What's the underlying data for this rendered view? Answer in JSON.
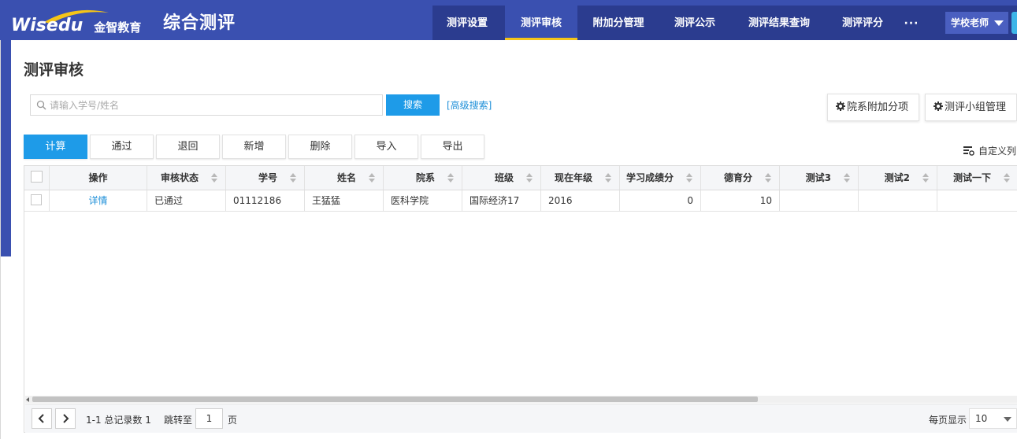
{
  "header": {
    "logo_text": "Wisedu",
    "logo_cn": "金智教育",
    "app_title": "综合测评",
    "nav": [
      {
        "label": "测评设置",
        "active": false
      },
      {
        "label": "测评审核",
        "active": true
      },
      {
        "label": "附加分管理",
        "active": false
      },
      {
        "label": "测评公示",
        "active": false
      },
      {
        "label": "测评结果查询",
        "active": false
      },
      {
        "label": "测评评分",
        "active": false
      }
    ],
    "more_label": "···",
    "user_label": "学校老师"
  },
  "page_title": "测评审核",
  "search": {
    "placeholder": "请输入学号/姓名",
    "value": "",
    "button_label": "搜索",
    "advanced_label": "[高级搜索]"
  },
  "right_buttons": {
    "dept_bonus": "院系附加分项",
    "group_manage": "测评小组管理"
  },
  "toolbar": [
    "计算",
    "通过",
    "退回",
    "新增",
    "删除",
    "导入",
    "导出"
  ],
  "custom_columns_label": "自定义列",
  "table": {
    "columns": [
      "操作",
      "审核状态",
      "学号",
      "姓名",
      "院系",
      "班级",
      "现在年级",
      "学习成绩分",
      "德育分",
      "测试3",
      "测试2",
      "测试一下"
    ],
    "rows": [
      {
        "action": "详情",
        "status": "已通过",
        "student_id": "01112186",
        "name": "王猛猛",
        "dept": "医科学院",
        "class": "国际经济17",
        "grade": "2016",
        "study_score": "0",
        "moral_score": "10",
        "test3": "",
        "test2": "",
        "test_yixia": ""
      }
    ]
  },
  "pager": {
    "summary": "1-1 总记录数 1",
    "jump_label": "跳转至",
    "page": "1",
    "page_unit": "页",
    "per_page_label": "每页显示",
    "per_page": "10"
  },
  "colors": {
    "header_bg": "#3a50b0",
    "nav_bg": "#2b3c8f",
    "active_underline": "#f5c518",
    "primary": "#1e9be8",
    "link": "#1e8fd8"
  }
}
